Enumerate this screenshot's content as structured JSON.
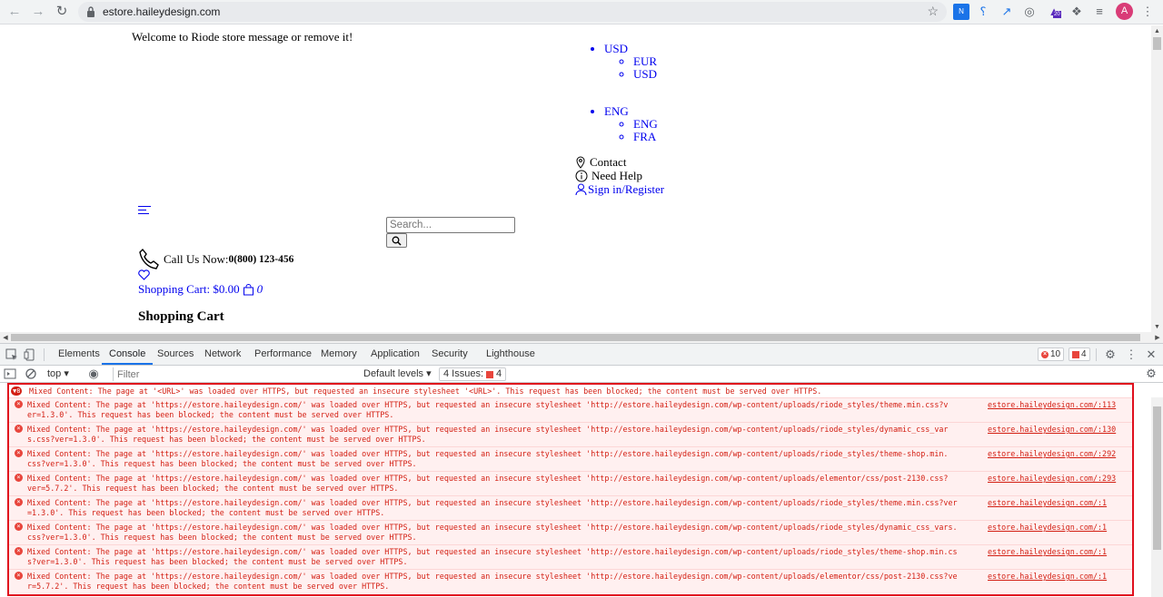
{
  "browser": {
    "url": "estore.haileydesign.com",
    "profile_initial": "A",
    "ext_badge": "20"
  },
  "page": {
    "welcome": "Welcome to Riode store message or remove it!",
    "currency": {
      "current": "USD",
      "options": [
        "EUR",
        "USD"
      ]
    },
    "language": {
      "current": "ENG",
      "options": [
        "ENG",
        "FRA"
      ]
    },
    "contact": "Contact",
    "help": "Need Help",
    "signin": "Sign in/Register",
    "search_placeholder": "Search...",
    "call_label": "Call Us Now:",
    "call_number": "0(800) 123-456",
    "cart_label": "Shopping Cart: $0.00",
    "cart_count": "0",
    "heading": "Shopping Cart"
  },
  "devtools": {
    "tabs": [
      "Elements",
      "Console",
      "Sources",
      "Network",
      "Performance",
      "Memory",
      "Application",
      "Security",
      "Lighthouse"
    ],
    "error_count": "10",
    "issue_count": "4",
    "context": "top",
    "filter_placeholder": "Filter",
    "levels": "Default levels",
    "issues_label": "4 Issues:",
    "issues_badge": "4",
    "group": {
      "count": "8",
      "text": "Mixed Content: The page at '<URL>' was loaded over HTTPS, but requested an insecure stylesheet '<URL>'. This request has been blocked; the content must be served over HTTPS."
    },
    "messages": [
      {
        "l1": "Mixed Content: The page at 'https://estore.haileydesign.com/' was loaded over HTTPS, but requested an insecure stylesheet 'http://estore.haileydesign.com/wp-content/uploads/riode_styles/theme.min.css?v",
        "l2": "er=1.3.0'. This request has been blocked; the content must be served over HTTPS.",
        "src": "estore.haileydesign.com/:113"
      },
      {
        "l1": "Mixed Content: The page at 'https://estore.haileydesign.com/' was loaded over HTTPS, but requested an insecure stylesheet 'http://estore.haileydesign.com/wp-content/uploads/riode_styles/dynamic_css_var",
        "l2": "s.css?ver=1.3.0'. This request has been blocked; the content must be served over HTTPS.",
        "src": "estore.haileydesign.com/:130"
      },
      {
        "l1": "Mixed Content: The page at 'https://estore.haileydesign.com/' was loaded over HTTPS, but requested an insecure stylesheet 'http://estore.haileydesign.com/wp-content/uploads/riode_styles/theme-shop.min.",
        "l2": "css?ver=1.3.0'. This request has been blocked; the content must be served over HTTPS.",
        "src": "estore.haileydesign.com/:292"
      },
      {
        "l1": "Mixed Content: The page at 'https://estore.haileydesign.com/' was loaded over HTTPS, but requested an insecure stylesheet 'http://estore.haileydesign.com/wp-content/uploads/elementor/css/post-2130.css?",
        "l2": "ver=5.7.2'. This request has been blocked; the content must be served over HTTPS.",
        "src": "estore.haileydesign.com/:293"
      },
      {
        "l1": "Mixed Content: The page at 'https://estore.haileydesign.com/' was loaded over HTTPS, but requested an insecure stylesheet 'http://estore.haileydesign.com/wp-content/uploads/riode_styles/theme.min.css?ver",
        "l2": "=1.3.0'. This request has been blocked; the content must be served over HTTPS.",
        "src": "estore.haileydesign.com/:1"
      },
      {
        "l1": "Mixed Content: The page at 'https://estore.haileydesign.com/' was loaded over HTTPS, but requested an insecure stylesheet 'http://estore.haileydesign.com/wp-content/uploads/riode_styles/dynamic_css_vars.",
        "l2": "css?ver=1.3.0'. This request has been blocked; the content must be served over HTTPS.",
        "src": "estore.haileydesign.com/:1"
      },
      {
        "l1": "Mixed Content: The page at 'https://estore.haileydesign.com/' was loaded over HTTPS, but requested an insecure stylesheet 'http://estore.haileydesign.com/wp-content/uploads/riode_styles/theme-shop.min.cs",
        "l2": "s?ver=1.3.0'. This request has been blocked; the content must be served over HTTPS.",
        "src": "estore.haileydesign.com/:1"
      },
      {
        "l1": "Mixed Content: The page at 'https://estore.haileydesign.com/' was loaded over HTTPS, but requested an insecure stylesheet 'http://estore.haileydesign.com/wp-content/uploads/elementor/css/post-2130.css?ve",
        "l2": "r=5.7.2'. This request has been blocked; the content must be served over HTTPS.",
        "src": "estore.haileydesign.com/:1"
      }
    ]
  }
}
